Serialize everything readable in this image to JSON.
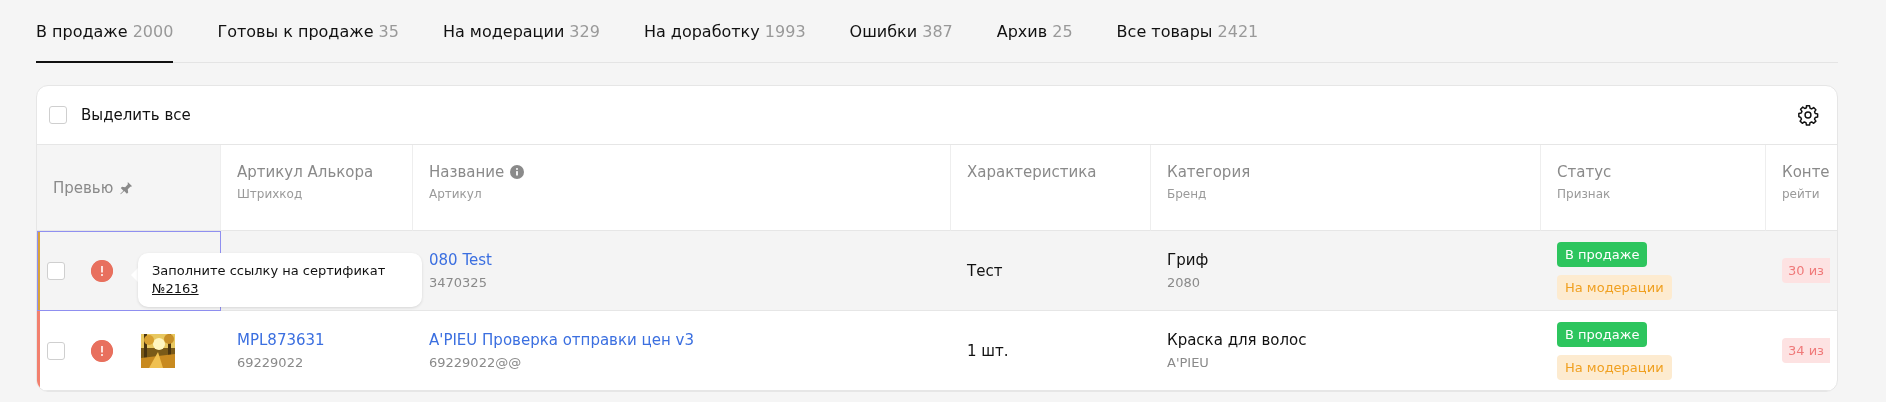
{
  "tabs": [
    {
      "label": "В продаже",
      "count": "2000",
      "selected": true
    },
    {
      "label": "Готовы к продаже",
      "count": "35",
      "selected": false
    },
    {
      "label": "На модерации",
      "count": "329",
      "selected": false
    },
    {
      "label": "На доработку",
      "count": "1993",
      "selected": false
    },
    {
      "label": "Ошибки",
      "count": "387",
      "selected": false
    },
    {
      "label": "Архив",
      "count": "25",
      "selected": false
    },
    {
      "label": "Все товары",
      "count": "2421",
      "selected": false
    }
  ],
  "toolbar": {
    "select_all": {
      "label": "Выделить все",
      "checked": false
    }
  },
  "table": {
    "columns": [
      {
        "title": "Превью",
        "pinned": true
      },
      {
        "title": "Артикул Алькора",
        "subtitle": "Штрихкод"
      },
      {
        "title": "Название",
        "subtitle": "Артикул",
        "hint": true
      },
      {
        "title": "Характеристика"
      },
      {
        "title": "Категория",
        "subtitle": "Бренд"
      },
      {
        "title": "Статус",
        "subtitle": "Признак"
      },
      {
        "title": "Конте",
        "subtitle": "рейти"
      }
    ],
    "rows": [
      {
        "highlighted": true,
        "color": "#d9a23a",
        "checked": false,
        "error": true,
        "name": "080 Test",
        "name_article": "3470325",
        "characteristic": "Тест",
        "category": "Гриф",
        "brand": "2080",
        "statuses": [
          {
            "label": "В продаже",
            "kind": "sale"
          },
          {
            "label": "На модерации",
            "kind": "moderation"
          }
        ],
        "rating": "30 из"
      },
      {
        "highlighted": false,
        "color": "#f2806e",
        "checked": false,
        "error": true,
        "article": "MPL873631",
        "barcode": "69229022",
        "name": "A'PIEU Проверка отправки цен v3",
        "name_article": "69229022@@",
        "characteristic": "1 шт.",
        "category": "Краска для волос",
        "brand": "A'PIEU",
        "statuses": [
          {
            "label": "В продаже",
            "kind": "sale"
          },
          {
            "label": "На модерации",
            "kind": "moderation"
          }
        ],
        "rating": "34 из"
      }
    ]
  },
  "tooltip": {
    "text": "Заполните ссылку на сертификат",
    "link": "№2163"
  }
}
